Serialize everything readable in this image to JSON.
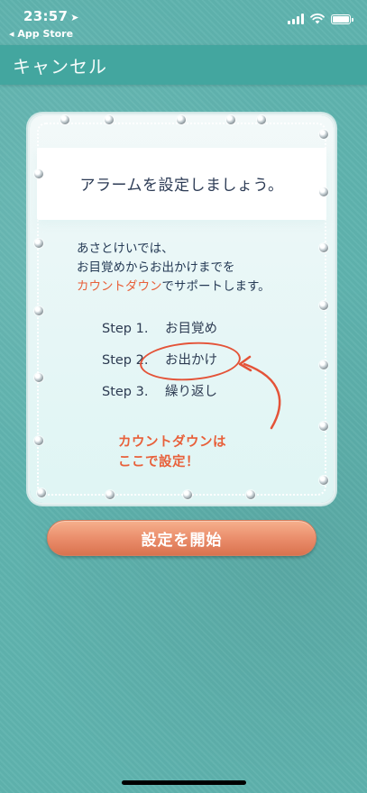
{
  "status_bar": {
    "time": "23:57",
    "location_arrow": "◂",
    "back_app": "◂ App Store"
  },
  "nav": {
    "cancel_label": "キャンセル"
  },
  "card": {
    "title": "アラームを設定しましょう。",
    "intro": {
      "line1": "あさとけいでは、",
      "line2": "お目覚めからお出かけまでを",
      "line3_highlight": "カウントダウン",
      "line3_rest": "でサポートします。"
    },
    "steps": [
      {
        "number": "Step 1.",
        "label": "お目覚め"
      },
      {
        "number": "Step 2.",
        "label": "お出かけ"
      },
      {
        "number": "Step 3.",
        "label": "繰り返し"
      }
    ],
    "annotation": {
      "line1": "カウントダウンは",
      "line2": "ここで設定！"
    }
  },
  "start_button": {
    "label": "設定を開始"
  },
  "colors": {
    "background": "#5fb3ae",
    "navbar": "#43a69f",
    "accent_orange": "#e8603a",
    "button": "#e98b69",
    "text_dark": "#2c3b55"
  },
  "icons": [
    "location-arrow-icon",
    "signal-icon",
    "wifi-icon",
    "battery-icon",
    "curved-arrow-icon"
  ]
}
